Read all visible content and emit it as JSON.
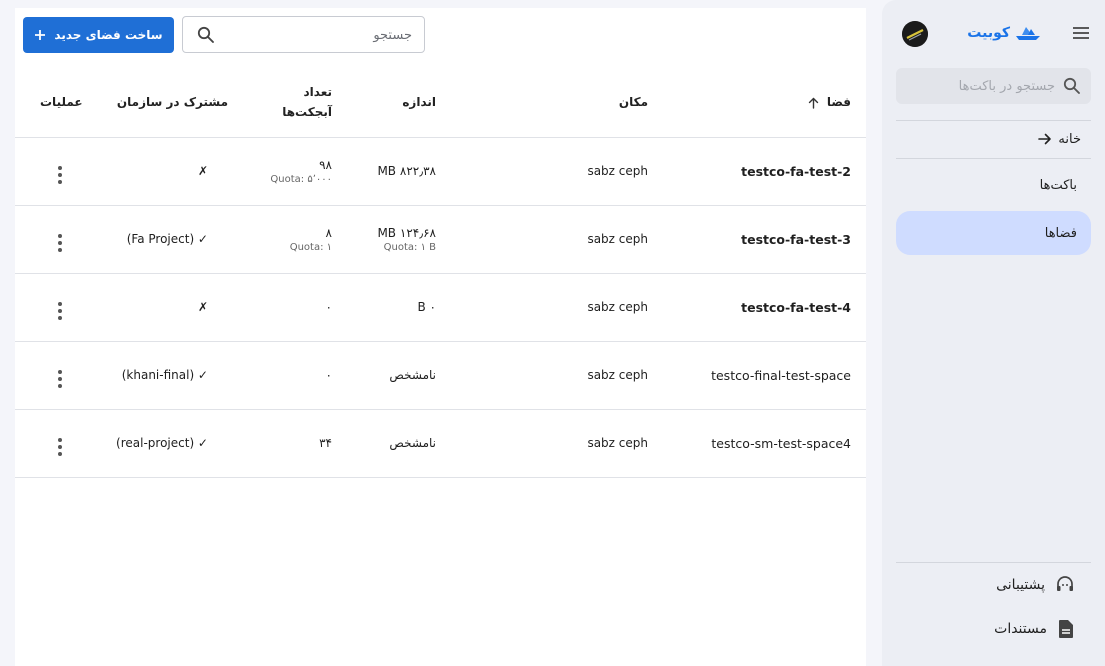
{
  "sidebar": {
    "brand": "کوبیت",
    "search_placeholder": "جستجو در باکت‌ها",
    "home_label": "خانه",
    "items": [
      {
        "label": "باکت‌ها",
        "active": false
      },
      {
        "label": "فضاها",
        "active": true
      }
    ],
    "footer": [
      {
        "label": "پشتیبانی",
        "icon": "support-icon"
      },
      {
        "label": "مستندات",
        "icon": "document-icon"
      }
    ]
  },
  "toolbar": {
    "create_label": "ساخت فضای جدید",
    "search_placeholder": "جستجو"
  },
  "table": {
    "headers": {
      "space": "فضا",
      "location": "مکان",
      "size": "اندازه",
      "count": "تعداد آبجکت‌ها",
      "shared": "مشترک در سازمان",
      "ops": "عملیات"
    },
    "rows": [
      {
        "space": "testco-fa-test-2",
        "bold": true,
        "location": "sabz ceph",
        "size": "۸۲۲٫۳۸ MB",
        "size_quota": "",
        "count": "۹۸",
        "count_quota": "Quota: ۵٬۰۰۰",
        "shared": "✗"
      },
      {
        "space": "testco-fa-test-3",
        "bold": true,
        "location": "sabz ceph",
        "size": "۱۲۴٫۶۸ MB",
        "size_quota": "Quota: ۱ B",
        "count": "۸",
        "count_quota": "Quota: ۱",
        "shared": "✓ (Fa Project)"
      },
      {
        "space": "testco-fa-test-4",
        "bold": true,
        "location": "sabz ceph",
        "size": "۰ B",
        "size_quota": "",
        "count": "۰",
        "count_quota": "",
        "shared": "✗"
      },
      {
        "space": "testco-final-test-space",
        "bold": false,
        "location": "sabz ceph",
        "size": "نامشخص",
        "size_quota": "",
        "count": "۰",
        "count_quota": "",
        "shared": "✓ (khani-final)"
      },
      {
        "space": "testco-sm-test-space4",
        "bold": false,
        "location": "sabz ceph",
        "size": "نامشخص",
        "size_quota": "",
        "count": "۳۴",
        "count_quota": "",
        "shared": "✓ (real-project)"
      }
    ]
  },
  "colors": {
    "accent": "#1f6fd6",
    "active_nav": "#cfdcff",
    "sidebar_bg": "#eceef4"
  }
}
